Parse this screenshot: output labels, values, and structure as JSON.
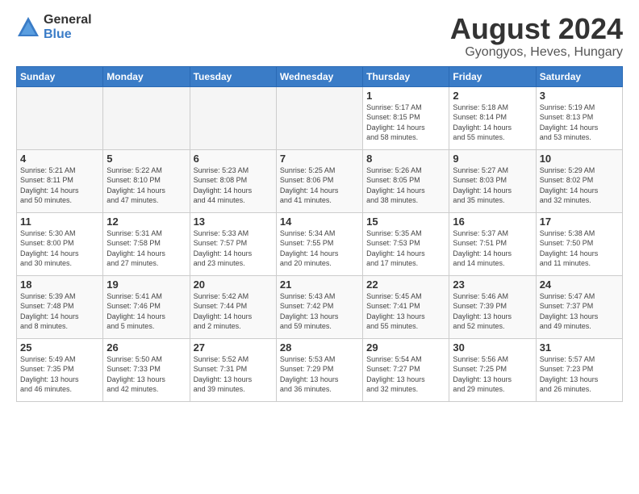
{
  "header": {
    "logo_general": "General",
    "logo_blue": "Blue",
    "main_title": "August 2024",
    "subtitle": "Gyongyos, Heves, Hungary"
  },
  "columns": [
    "Sunday",
    "Monday",
    "Tuesday",
    "Wednesday",
    "Thursday",
    "Friday",
    "Saturday"
  ],
  "weeks": [
    [
      {
        "day": "",
        "empty": true
      },
      {
        "day": "",
        "empty": true
      },
      {
        "day": "",
        "empty": true
      },
      {
        "day": "",
        "empty": true
      },
      {
        "day": "1",
        "line1": "Sunrise: 5:17 AM",
        "line2": "Sunset: 8:15 PM",
        "line3": "Daylight: 14 hours",
        "line4": "and 58 minutes."
      },
      {
        "day": "2",
        "line1": "Sunrise: 5:18 AM",
        "line2": "Sunset: 8:14 PM",
        "line3": "Daylight: 14 hours",
        "line4": "and 55 minutes."
      },
      {
        "day": "3",
        "line1": "Sunrise: 5:19 AM",
        "line2": "Sunset: 8:13 PM",
        "line3": "Daylight: 14 hours",
        "line4": "and 53 minutes."
      }
    ],
    [
      {
        "day": "4",
        "line1": "Sunrise: 5:21 AM",
        "line2": "Sunset: 8:11 PM",
        "line3": "Daylight: 14 hours",
        "line4": "and 50 minutes."
      },
      {
        "day": "5",
        "line1": "Sunrise: 5:22 AM",
        "line2": "Sunset: 8:10 PM",
        "line3": "Daylight: 14 hours",
        "line4": "and 47 minutes."
      },
      {
        "day": "6",
        "line1": "Sunrise: 5:23 AM",
        "line2": "Sunset: 8:08 PM",
        "line3": "Daylight: 14 hours",
        "line4": "and 44 minutes."
      },
      {
        "day": "7",
        "line1": "Sunrise: 5:25 AM",
        "line2": "Sunset: 8:06 PM",
        "line3": "Daylight: 14 hours",
        "line4": "and 41 minutes."
      },
      {
        "day": "8",
        "line1": "Sunrise: 5:26 AM",
        "line2": "Sunset: 8:05 PM",
        "line3": "Daylight: 14 hours",
        "line4": "and 38 minutes."
      },
      {
        "day": "9",
        "line1": "Sunrise: 5:27 AM",
        "line2": "Sunset: 8:03 PM",
        "line3": "Daylight: 14 hours",
        "line4": "and 35 minutes."
      },
      {
        "day": "10",
        "line1": "Sunrise: 5:29 AM",
        "line2": "Sunset: 8:02 PM",
        "line3": "Daylight: 14 hours",
        "line4": "and 32 minutes."
      }
    ],
    [
      {
        "day": "11",
        "line1": "Sunrise: 5:30 AM",
        "line2": "Sunset: 8:00 PM",
        "line3": "Daylight: 14 hours",
        "line4": "and 30 minutes."
      },
      {
        "day": "12",
        "line1": "Sunrise: 5:31 AM",
        "line2": "Sunset: 7:58 PM",
        "line3": "Daylight: 14 hours",
        "line4": "and 27 minutes."
      },
      {
        "day": "13",
        "line1": "Sunrise: 5:33 AM",
        "line2": "Sunset: 7:57 PM",
        "line3": "Daylight: 14 hours",
        "line4": "and 23 minutes."
      },
      {
        "day": "14",
        "line1": "Sunrise: 5:34 AM",
        "line2": "Sunset: 7:55 PM",
        "line3": "Daylight: 14 hours",
        "line4": "and 20 minutes."
      },
      {
        "day": "15",
        "line1": "Sunrise: 5:35 AM",
        "line2": "Sunset: 7:53 PM",
        "line3": "Daylight: 14 hours",
        "line4": "and 17 minutes."
      },
      {
        "day": "16",
        "line1": "Sunrise: 5:37 AM",
        "line2": "Sunset: 7:51 PM",
        "line3": "Daylight: 14 hours",
        "line4": "and 14 minutes."
      },
      {
        "day": "17",
        "line1": "Sunrise: 5:38 AM",
        "line2": "Sunset: 7:50 PM",
        "line3": "Daylight: 14 hours",
        "line4": "and 11 minutes."
      }
    ],
    [
      {
        "day": "18",
        "line1": "Sunrise: 5:39 AM",
        "line2": "Sunset: 7:48 PM",
        "line3": "Daylight: 14 hours",
        "line4": "and 8 minutes."
      },
      {
        "day": "19",
        "line1": "Sunrise: 5:41 AM",
        "line2": "Sunset: 7:46 PM",
        "line3": "Daylight: 14 hours",
        "line4": "and 5 minutes."
      },
      {
        "day": "20",
        "line1": "Sunrise: 5:42 AM",
        "line2": "Sunset: 7:44 PM",
        "line3": "Daylight: 14 hours",
        "line4": "and 2 minutes."
      },
      {
        "day": "21",
        "line1": "Sunrise: 5:43 AM",
        "line2": "Sunset: 7:42 PM",
        "line3": "Daylight: 13 hours",
        "line4": "and 59 minutes."
      },
      {
        "day": "22",
        "line1": "Sunrise: 5:45 AM",
        "line2": "Sunset: 7:41 PM",
        "line3": "Daylight: 13 hours",
        "line4": "and 55 minutes."
      },
      {
        "day": "23",
        "line1": "Sunrise: 5:46 AM",
        "line2": "Sunset: 7:39 PM",
        "line3": "Daylight: 13 hours",
        "line4": "and 52 minutes."
      },
      {
        "day": "24",
        "line1": "Sunrise: 5:47 AM",
        "line2": "Sunset: 7:37 PM",
        "line3": "Daylight: 13 hours",
        "line4": "and 49 minutes."
      }
    ],
    [
      {
        "day": "25",
        "line1": "Sunrise: 5:49 AM",
        "line2": "Sunset: 7:35 PM",
        "line3": "Daylight: 13 hours",
        "line4": "and 46 minutes."
      },
      {
        "day": "26",
        "line1": "Sunrise: 5:50 AM",
        "line2": "Sunset: 7:33 PM",
        "line3": "Daylight: 13 hours",
        "line4": "and 42 minutes."
      },
      {
        "day": "27",
        "line1": "Sunrise: 5:52 AM",
        "line2": "Sunset: 7:31 PM",
        "line3": "Daylight: 13 hours",
        "line4": "and 39 minutes."
      },
      {
        "day": "28",
        "line1": "Sunrise: 5:53 AM",
        "line2": "Sunset: 7:29 PM",
        "line3": "Daylight: 13 hours",
        "line4": "and 36 minutes."
      },
      {
        "day": "29",
        "line1": "Sunrise: 5:54 AM",
        "line2": "Sunset: 7:27 PM",
        "line3": "Daylight: 13 hours",
        "line4": "and 32 minutes."
      },
      {
        "day": "30",
        "line1": "Sunrise: 5:56 AM",
        "line2": "Sunset: 7:25 PM",
        "line3": "Daylight: 13 hours",
        "line4": "and 29 minutes."
      },
      {
        "day": "31",
        "line1": "Sunrise: 5:57 AM",
        "line2": "Sunset: 7:23 PM",
        "line3": "Daylight: 13 hours",
        "line4": "and 26 minutes."
      }
    ]
  ]
}
